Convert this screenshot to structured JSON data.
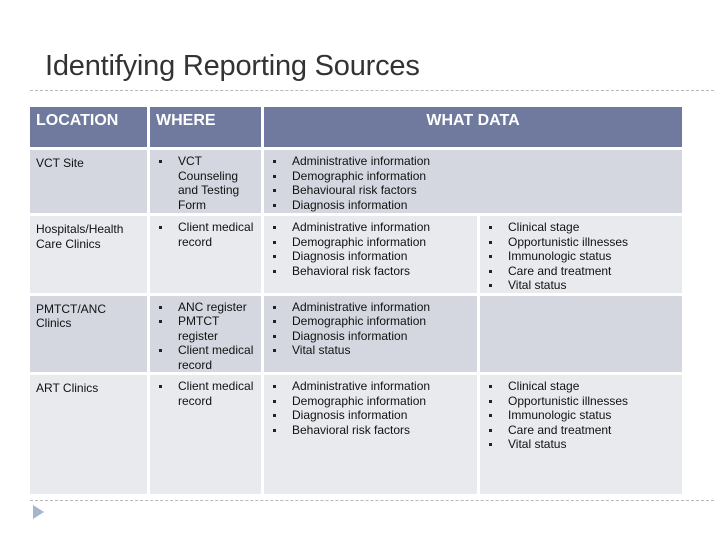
{
  "slide": {
    "title": "Identifying Reporting Sources"
  },
  "table": {
    "headers": {
      "location": "LOCATION",
      "where": "WHERE",
      "what_data": "WHAT DATA"
    },
    "rows": [
      {
        "location": "VCT Site",
        "where": [
          "VCT Counseling and Testing Form"
        ],
        "what": [
          "Administrative information",
          "Demographic information",
          "Behavioural risk factors",
          "Diagnosis information"
        ],
        "extra": []
      },
      {
        "location": "Hospitals/Health Care Clinics",
        "where": [
          "Client medical record"
        ],
        "what": [
          "Administrative information",
          "Demographic information",
          "Diagnosis information",
          "Behavioral risk factors"
        ],
        "extra": [
          "Clinical stage",
          "Opportunistic illnesses",
          "Immunologic status",
          "Care and treatment",
          "Vital status"
        ]
      },
      {
        "location": "PMTCT/ANC Clinics",
        "where": [
          "ANC register",
          "PMTCT register",
          "Client medical record"
        ],
        "what": [
          "Administrative information",
          "Demographic information",
          "Diagnosis information",
          "Vital status"
        ],
        "extra": []
      },
      {
        "location": "ART Clinics",
        "where": [
          "Client medical record"
        ],
        "what": [
          "Administrative information",
          "Demographic information",
          "Diagnosis information",
          "Behavioral risk factors"
        ],
        "extra": [
          "Clinical stage",
          "Opportunistic illnesses",
          "Immunologic status",
          "Care and treatment",
          "Vital status"
        ]
      }
    ]
  },
  "colors": {
    "header_bg": "#6f7a9e",
    "row_dark": "#d4d7df",
    "row_light": "#e9eaee",
    "nav_arrow": "#a6b6cf"
  },
  "icons": {
    "nav": "next-slide-arrow-icon"
  }
}
